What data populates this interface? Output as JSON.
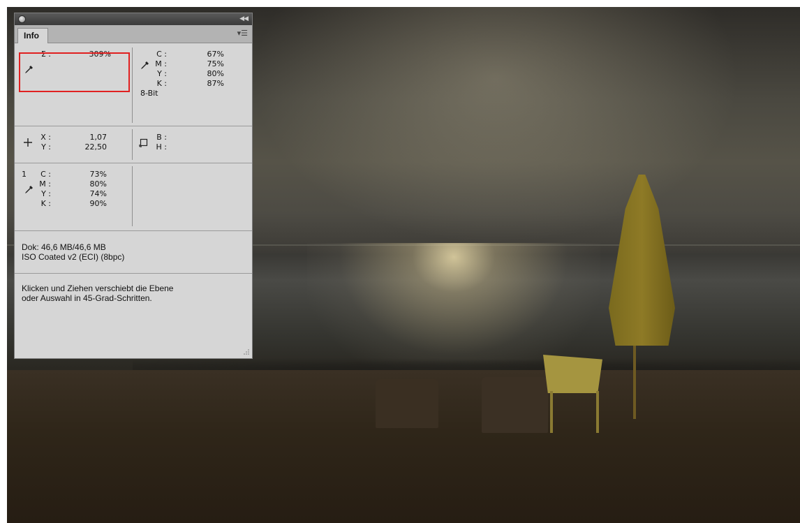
{
  "panel": {
    "tab_label": "Info",
    "total_ink": {
      "label": "Σ :",
      "value": "309%"
    },
    "cmyk_primary": {
      "rows": [
        {
          "label": "C :",
          "value": "67%"
        },
        {
          "label": "M :",
          "value": "75%"
        },
        {
          "label": "Y :",
          "value": "80%"
        },
        {
          "label": "K :",
          "value": "87%"
        }
      ],
      "bit_depth": "8-Bit"
    },
    "position": {
      "x_label": "X :",
      "x_value": "1,07",
      "y_label": "Y :",
      "y_value": "22,50"
    },
    "selection": {
      "w_label": "B :",
      "h_label": "H :"
    },
    "sampler1": {
      "index": "1",
      "rows": [
        {
          "label": "C :",
          "value": "73%"
        },
        {
          "label": "M :",
          "value": "80%"
        },
        {
          "label": "Y :",
          "value": "74%"
        },
        {
          "label": "K :",
          "value": "90%"
        }
      ]
    },
    "doc_size": "Dok: 46,6 MB/46,6 MB",
    "color_profile": "ISO Coated v2 (ECI) (8bpc)",
    "tool_hint_line1": "Klicken und Ziehen verschiebt die Ebene",
    "tool_hint_line2": "oder Auswahl in 45-Grad-Schritten."
  },
  "colors": {
    "highlight": "#e02020",
    "panel_bg": "#d6d6d6"
  },
  "icons": [
    "close-icon",
    "collapse-icon",
    "panel-menu-icon",
    "eyedropper-icon",
    "crosshair-icon",
    "selection-size-icon",
    "resize-grip-icon"
  ]
}
